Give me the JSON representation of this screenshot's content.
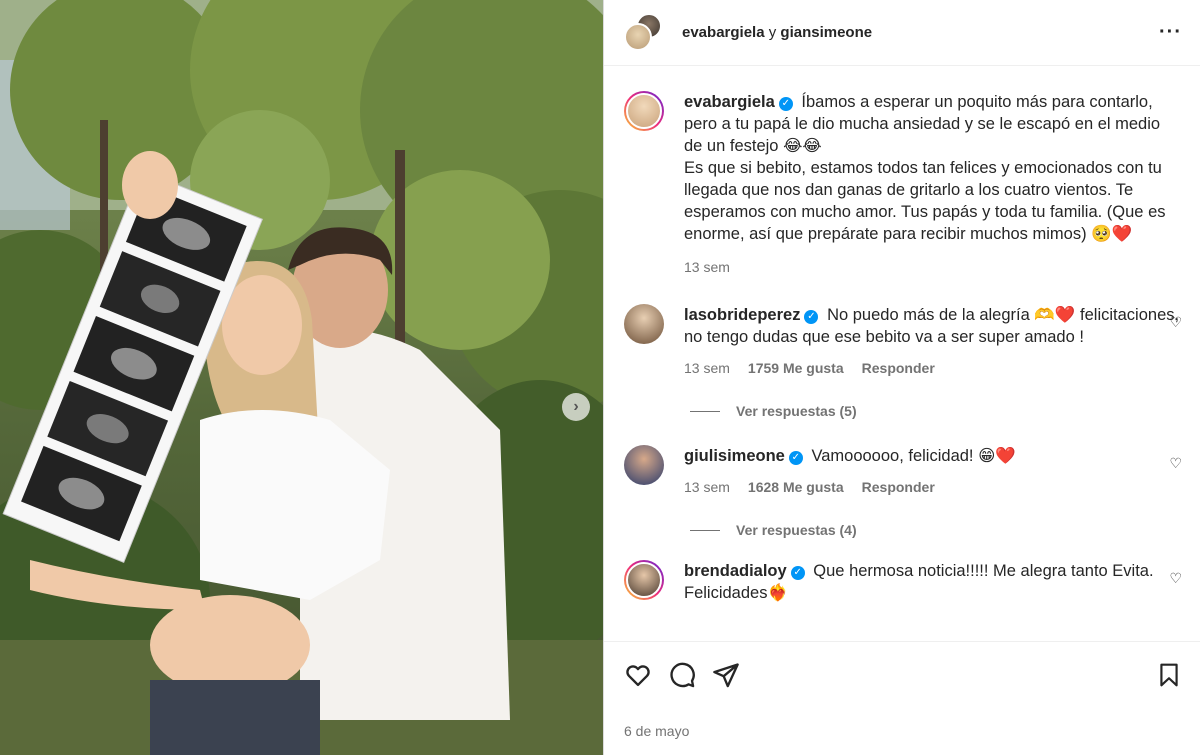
{
  "header": {
    "user1": "evabargiela",
    "conj": "y",
    "user2": "giansimeone"
  },
  "caption": {
    "user": "evabargiela",
    "text": "Íbamos a esperar un poquito más para contarlo, pero a tu papá le dio mucha ansiedad y se le escapó en el medio de un festejo 😂😂",
    "text2": "Es que si bebito, estamos todos tan felices y emocionados con tu llegada que nos dan ganas de gritarlo a los cuatro vientos. Te esperamos con mucho amor. Tus papás y toda tu familia. (Que es enorme, así que prepárate para recibir muchos mimos) 🥺❤️",
    "time": "13 sem"
  },
  "comments": [
    {
      "user": "lasobrideperez",
      "text": "No puedo más de la alegría 🫶❤️ felicitaciones, no tengo dudas que ese bebito va a ser super amado !",
      "time": "13 sem",
      "likes": "1759 Me gusta",
      "reply": "Responder",
      "view_replies": "Ver respuestas (5)"
    },
    {
      "user": "giulisimeone",
      "text": "Vamoooooo, felicidad! 😁❤️",
      "time": "13 sem",
      "likes": "1628 Me gusta",
      "reply": "Responder",
      "view_replies": "Ver respuestas (4)"
    },
    {
      "user": "brendadialoy",
      "text": "Que hermosa noticia!!!!! Me alegra tanto Evita. Felicidades❤️‍🔥"
    }
  ],
  "date": "6 de mayo",
  "icons": [
    "heart-icon",
    "comment-icon",
    "share-icon",
    "bookmark-icon",
    "more-icon",
    "verified-icon"
  ],
  "colors": {
    "verified": "#0095f6",
    "muted": "#737373",
    "text": "#262626"
  }
}
